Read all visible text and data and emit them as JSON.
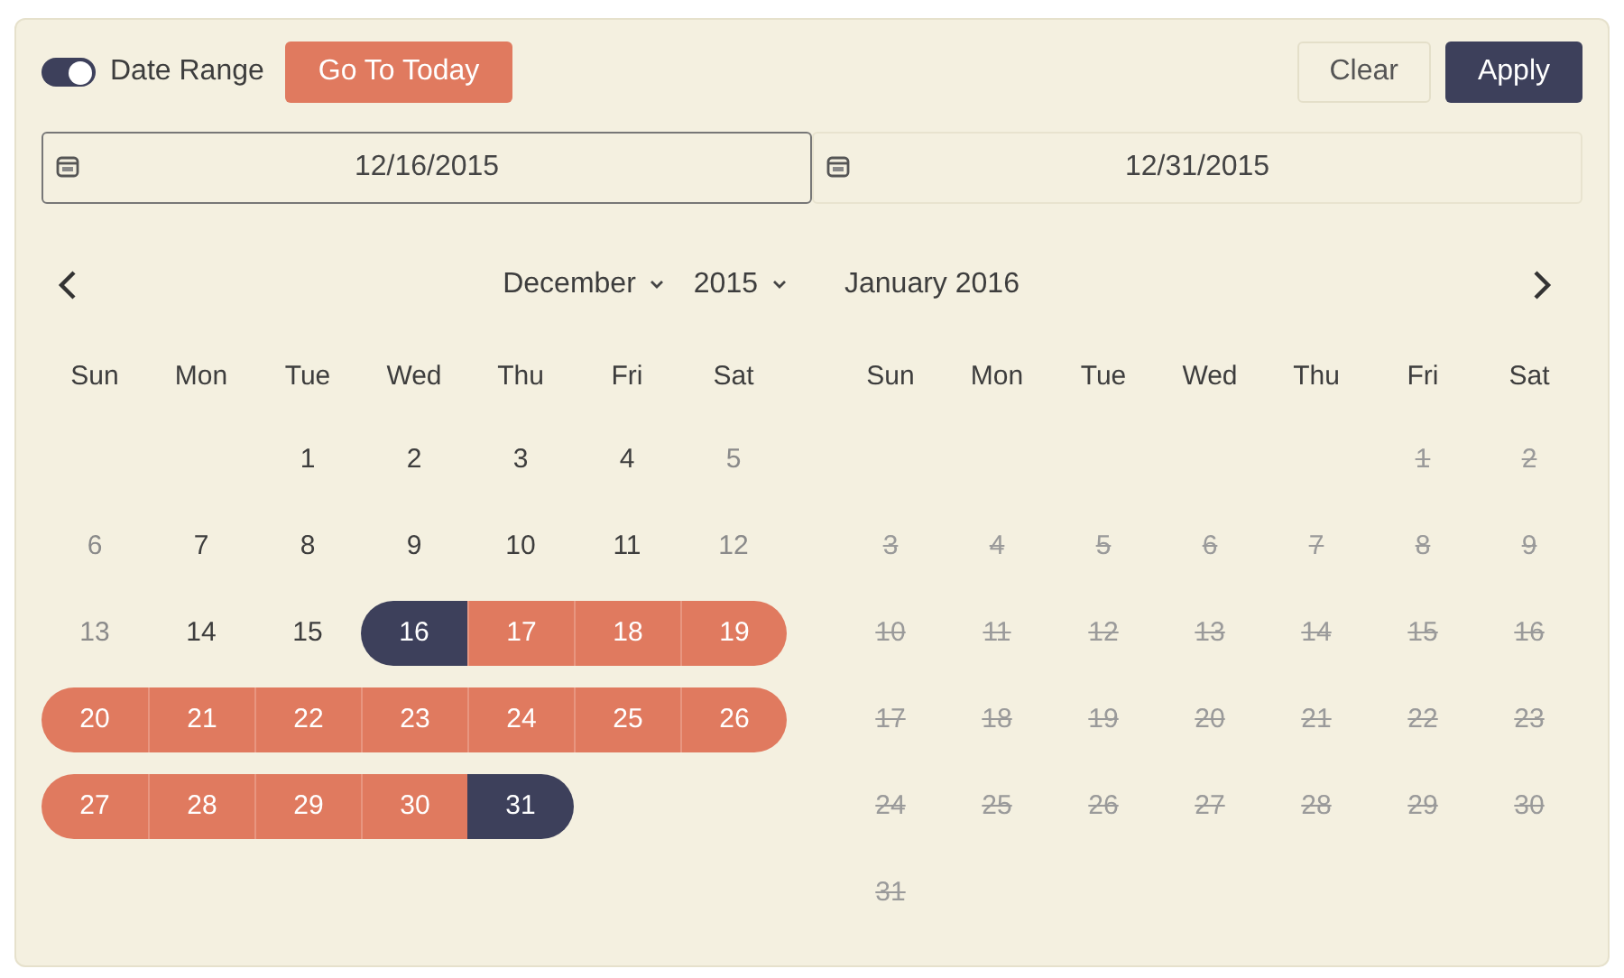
{
  "toolbar": {
    "toggle": {
      "label": "Date Range",
      "checked": true
    },
    "today_button": "Go To Today",
    "clear_button": "Clear",
    "apply_button": "Apply"
  },
  "inputs": [
    {
      "value": "12/16/2015",
      "focused": true
    },
    {
      "value": "12/31/2015",
      "focused": false
    }
  ],
  "months": [
    {
      "kind": "dropdowns",
      "month": "December",
      "year": "2015",
      "weekdays": [
        "Sun",
        "Mon",
        "Tue",
        "Wed",
        "Thu",
        "Fri",
        "Sat"
      ],
      "weeks": [
        [
          {
            "label": "1",
            "kind": "normal",
            "selected": false,
            "in_range": false
          },
          {
            "label": "2",
            "kind": "normal",
            "selected": false,
            "in_range": false
          },
          {
            "label": "3",
            "kind": "normal",
            "selected": false,
            "in_range": false
          },
          {
            "label": "4",
            "kind": "normal",
            "selected": false,
            "in_range": false
          },
          {
            "label": "5",
            "kind": "weekend",
            "selected": false,
            "in_range": false
          }
        ],
        [
          {
            "label": "6",
            "kind": "weekend",
            "selected": false,
            "in_range": false
          },
          {
            "label": "7",
            "kind": "normal",
            "selected": false,
            "in_range": false
          },
          {
            "label": "8",
            "kind": "normal",
            "selected": false,
            "in_range": false
          },
          {
            "label": "9",
            "kind": "normal",
            "selected": false,
            "in_range": false
          },
          {
            "label": "10",
            "kind": "normal",
            "selected": false,
            "in_range": false
          },
          {
            "label": "11",
            "kind": "normal",
            "selected": false,
            "in_range": false
          },
          {
            "label": "12",
            "kind": "weekend",
            "selected": false,
            "in_range": false
          }
        ],
        [
          {
            "label": "13",
            "kind": "weekend",
            "selected": false,
            "in_range": false
          },
          {
            "label": "14",
            "kind": "normal",
            "selected": false,
            "in_range": false
          },
          {
            "label": "15",
            "kind": "normal",
            "selected": false,
            "in_range": false
          },
          {
            "label": "16",
            "kind": "normal",
            "selected": true,
            "in_range": true
          },
          {
            "label": "17",
            "kind": "normal",
            "selected": false,
            "in_range": true
          },
          {
            "label": "18",
            "kind": "normal",
            "selected": false,
            "in_range": true
          },
          {
            "label": "19",
            "kind": "weekend",
            "selected": false,
            "in_range": true
          }
        ],
        [
          {
            "label": "20",
            "kind": "weekend",
            "selected": false,
            "in_range": true
          },
          {
            "label": "21",
            "kind": "normal",
            "selected": false,
            "in_range": true
          },
          {
            "label": "22",
            "kind": "normal",
            "selected": false,
            "in_range": true
          },
          {
            "label": "23",
            "kind": "normal",
            "selected": false,
            "in_range": true
          },
          {
            "label": "24",
            "kind": "normal",
            "selected": false,
            "in_range": true
          },
          {
            "label": "25",
            "kind": "normal",
            "selected": false,
            "in_range": true
          },
          {
            "label": "26",
            "kind": "weekend",
            "selected": false,
            "in_range": true
          }
        ],
        [
          {
            "label": "27",
            "kind": "weekend",
            "selected": false,
            "in_range": true
          },
          {
            "label": "28",
            "kind": "normal",
            "selected": false,
            "in_range": true
          },
          {
            "label": "29",
            "kind": "normal",
            "selected": false,
            "in_range": true
          },
          {
            "label": "30",
            "kind": "normal",
            "selected": false,
            "in_range": true
          },
          {
            "label": "31",
            "kind": "normal",
            "selected": true,
            "in_range": true
          }
        ]
      ]
    },
    {
      "kind": "title",
      "title": "January 2016",
      "weekdays": [
        "Sun",
        "Mon",
        "Tue",
        "Wed",
        "Thu",
        "Fri",
        "Sat"
      ],
      "weeks": [
        [
          {
            "label": "1",
            "kind": "disabled",
            "selected": false,
            "in_range": false
          },
          {
            "label": "2",
            "kind": "disabled",
            "selected": false,
            "in_range": false
          }
        ],
        [
          {
            "label": "3",
            "kind": "disabled",
            "selected": false,
            "in_range": false
          },
          {
            "label": "4",
            "kind": "disabled",
            "selected": false,
            "in_range": false
          },
          {
            "label": "5",
            "kind": "disabled",
            "selected": false,
            "in_range": false
          },
          {
            "label": "6",
            "kind": "disabled",
            "selected": false,
            "in_range": false
          },
          {
            "label": "7",
            "kind": "disabled",
            "selected": false,
            "in_range": false
          },
          {
            "label": "8",
            "kind": "disabled",
            "selected": false,
            "in_range": false
          },
          {
            "label": "9",
            "kind": "disabled",
            "selected": false,
            "in_range": false
          }
        ],
        [
          {
            "label": "10",
            "kind": "disabled",
            "selected": false,
            "in_range": false
          },
          {
            "label": "11",
            "kind": "disabled",
            "selected": false,
            "in_range": false
          },
          {
            "label": "12",
            "kind": "disabled",
            "selected": false,
            "in_range": false
          },
          {
            "label": "13",
            "kind": "disabled",
            "selected": false,
            "in_range": false
          },
          {
            "label": "14",
            "kind": "disabled",
            "selected": false,
            "in_range": false
          },
          {
            "label": "15",
            "kind": "disabled",
            "selected": false,
            "in_range": false
          },
          {
            "label": "16",
            "kind": "disabled",
            "selected": false,
            "in_range": false
          }
        ],
        [
          {
            "label": "17",
            "kind": "disabled",
            "selected": false,
            "in_range": false
          },
          {
            "label": "18",
            "kind": "disabled",
            "selected": false,
            "in_range": false
          },
          {
            "label": "19",
            "kind": "disabled",
            "selected": false,
            "in_range": false
          },
          {
            "label": "20",
            "kind": "disabled",
            "selected": false,
            "in_range": false
          },
          {
            "label": "21",
            "kind": "disabled",
            "selected": false,
            "in_range": false
          },
          {
            "label": "22",
            "kind": "disabled",
            "selected": false,
            "in_range": false
          },
          {
            "label": "23",
            "kind": "disabled",
            "selected": false,
            "in_range": false
          }
        ],
        [
          {
            "label": "24",
            "kind": "disabled",
            "selected": false,
            "in_range": false
          },
          {
            "label": "25",
            "kind": "disabled",
            "selected": false,
            "in_range": false
          },
          {
            "label": "26",
            "kind": "disabled",
            "selected": false,
            "in_range": false
          },
          {
            "label": "27",
            "kind": "disabled",
            "selected": false,
            "in_range": false
          },
          {
            "label": "28",
            "kind": "disabled",
            "selected": false,
            "in_range": false
          },
          {
            "label": "29",
            "kind": "disabled",
            "selected": false,
            "in_range": false
          },
          {
            "label": "30",
            "kind": "disabled",
            "selected": false,
            "in_range": false
          }
        ],
        [
          {
            "label": "31",
            "kind": "disabled",
            "selected": false,
            "in_range": false
          }
        ]
      ]
    }
  ]
}
